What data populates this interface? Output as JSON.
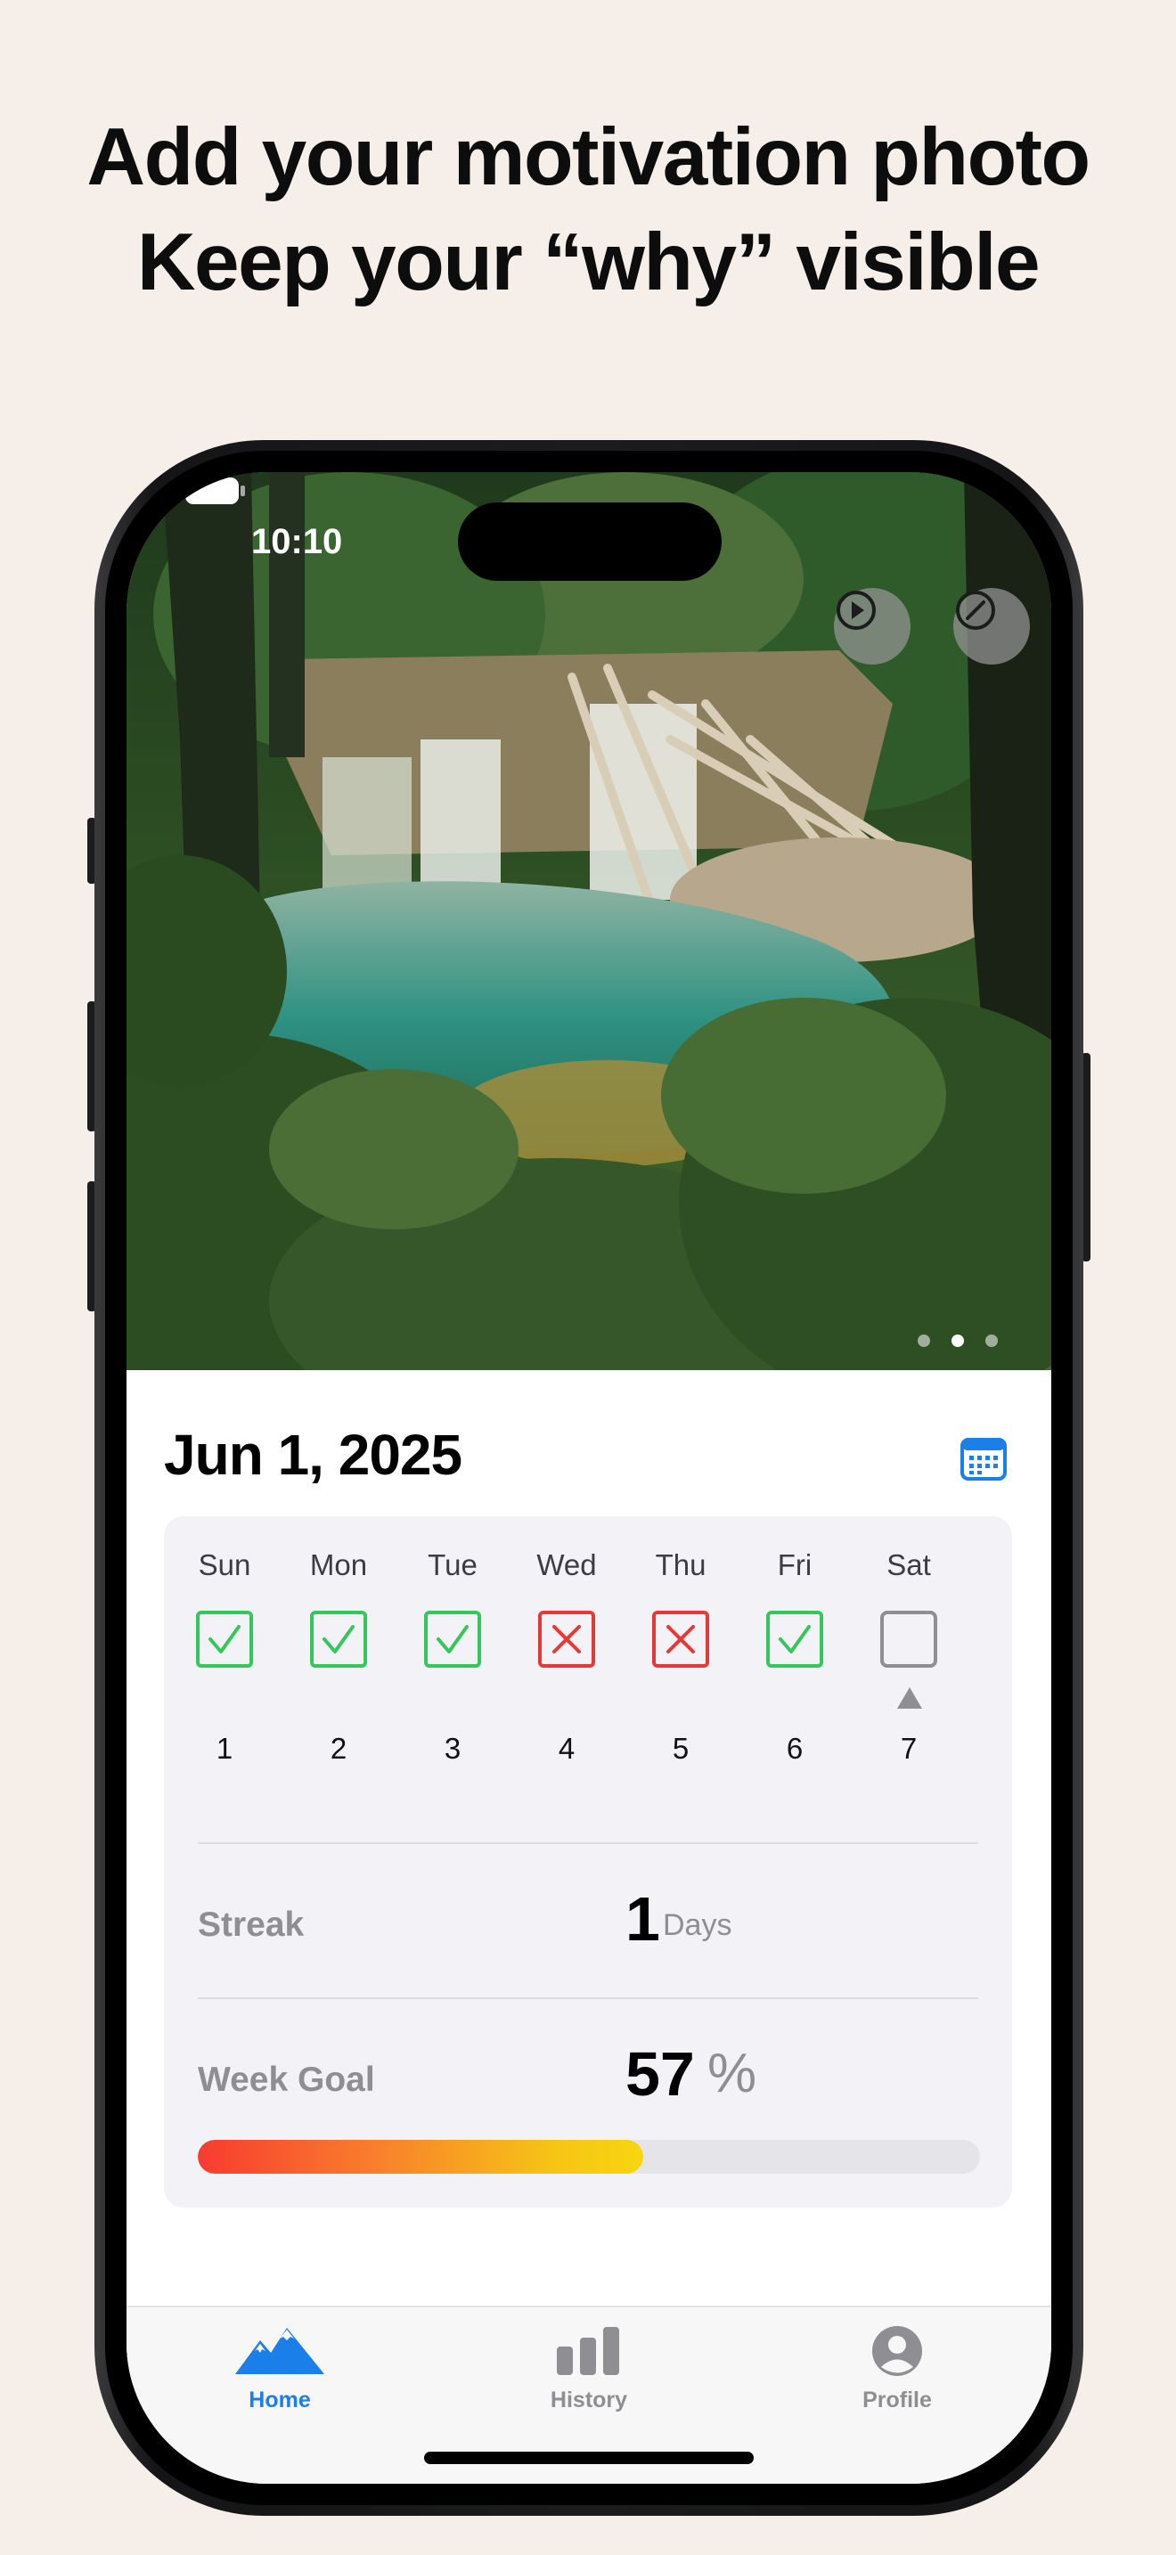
{
  "headline": {
    "line1": "Add your motivation photo",
    "line2": "Keep your “why” visible"
  },
  "status_bar": {
    "time": "10:10"
  },
  "photo": {
    "description_icon_names": [
      "play-circle-icon",
      "slash-circle-icon"
    ],
    "page_count": 3,
    "active_page": 2
  },
  "header": {
    "date": "Jun 1, 2025",
    "calendar_icon": "calendar-icon"
  },
  "week": {
    "days": [
      {
        "name": "Sun",
        "number": "1",
        "status": "done"
      },
      {
        "name": "Mon",
        "number": "2",
        "status": "done"
      },
      {
        "name": "Tue",
        "number": "3",
        "status": "done"
      },
      {
        "name": "Wed",
        "number": "4",
        "status": "missed"
      },
      {
        "name": "Thu",
        "number": "5",
        "status": "missed"
      },
      {
        "name": "Fri",
        "number": "6",
        "status": "done"
      },
      {
        "name": "Sat",
        "number": "7",
        "status": "empty",
        "today": true
      }
    ]
  },
  "stats": {
    "streak_label": "Streak",
    "streak_value": "1",
    "streak_unit": "Days",
    "goal_label": "Week Goal",
    "goal_value": "57",
    "goal_unit": "%",
    "goal_fraction": 0.57
  },
  "colors": {
    "check_green": "#34c759",
    "cross_red": "#e53935",
    "accent_blue": "#1a7fe8",
    "inactive_gray": "#8e8e93"
  },
  "tabbar": {
    "tabs": [
      {
        "label": "Home",
        "icon": "mountains-icon",
        "active": true
      },
      {
        "label": "History",
        "icon": "bar-chart-icon",
        "active": false
      },
      {
        "label": "Profile",
        "icon": "person-circle-icon",
        "active": false
      }
    ]
  }
}
